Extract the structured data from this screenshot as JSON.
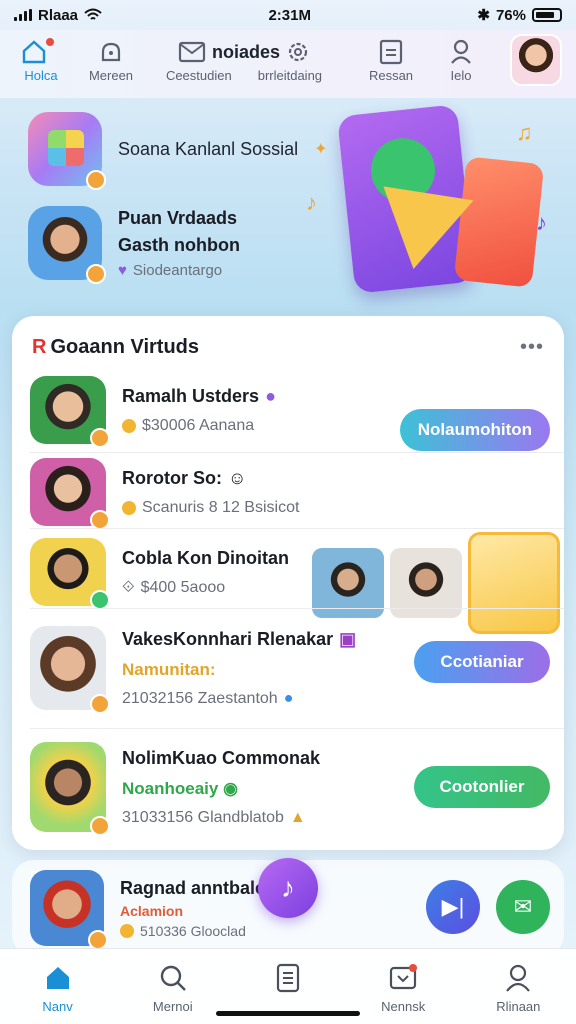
{
  "status_bar": {
    "carrier": "Rlaaa",
    "time": "2:31M",
    "battery": "76%"
  },
  "top_nav": {
    "items": [
      {
        "label": "Holca",
        "icon": "home-icon"
      },
      {
        "label": "Mereen",
        "icon": "bell-lock-icon"
      },
      {
        "label": "Ceestudien",
        "icon": "mail-icon"
      },
      {
        "label": "brrleitdaing",
        "icon": "settings-icon"
      },
      {
        "label": "Ressan",
        "icon": "document-icon"
      },
      {
        "label": "Ielo",
        "icon": "user-icon"
      }
    ],
    "center_title": "noiades"
  },
  "hero": {
    "title": "Soana Kanlanl Sossial",
    "name_line1": "Puan Vrdaads",
    "name_line2": "Gasth nohbon",
    "subtitle": "Siodeantargo"
  },
  "card": {
    "title_prefix": "R",
    "title": "Goaann Virtuds",
    "more": "•••",
    "rows": [
      {
        "name": "Ramalh Ustders",
        "meta": "$30006 Aanana",
        "button": "Nolaumohiton"
      },
      {
        "name": "Rorotor So:",
        "meta": "Scanuris 8 12 Bsisicot"
      },
      {
        "name": "Cobla Kon Dinoitan",
        "meta": "$400 5aooo"
      },
      {
        "name": "VakesKonnhari Rlenakar",
        "accent": "Namunitan:",
        "meta": "21032156 Zaestantoh",
        "button": "Ccotianiar"
      },
      {
        "name": "NolimKuao Commonak",
        "accent": "Noanhoeaiy",
        "meta": "31033156 Glandblatob",
        "button": "Cootonlier"
      }
    ]
  },
  "bottom_item": {
    "name": "Ragnad anntbale",
    "accent": "Aclamion",
    "meta": "510336 Glooclad"
  },
  "tabs": [
    {
      "label": "Nanv",
      "icon": "home-icon"
    },
    {
      "label": "Mernoi",
      "icon": "search-icon"
    },
    {
      "label": "",
      "icon": "document-icon"
    },
    {
      "label": "Nennsk",
      "icon": "inbox-icon"
    },
    {
      "label": "Rlinaan",
      "icon": "profile-icon"
    }
  ],
  "colors": {
    "accent": "#1a8fd6",
    "teal_button": "#3dc1d7",
    "green_button": "#34c48a",
    "purple": "#7b3fe0"
  }
}
